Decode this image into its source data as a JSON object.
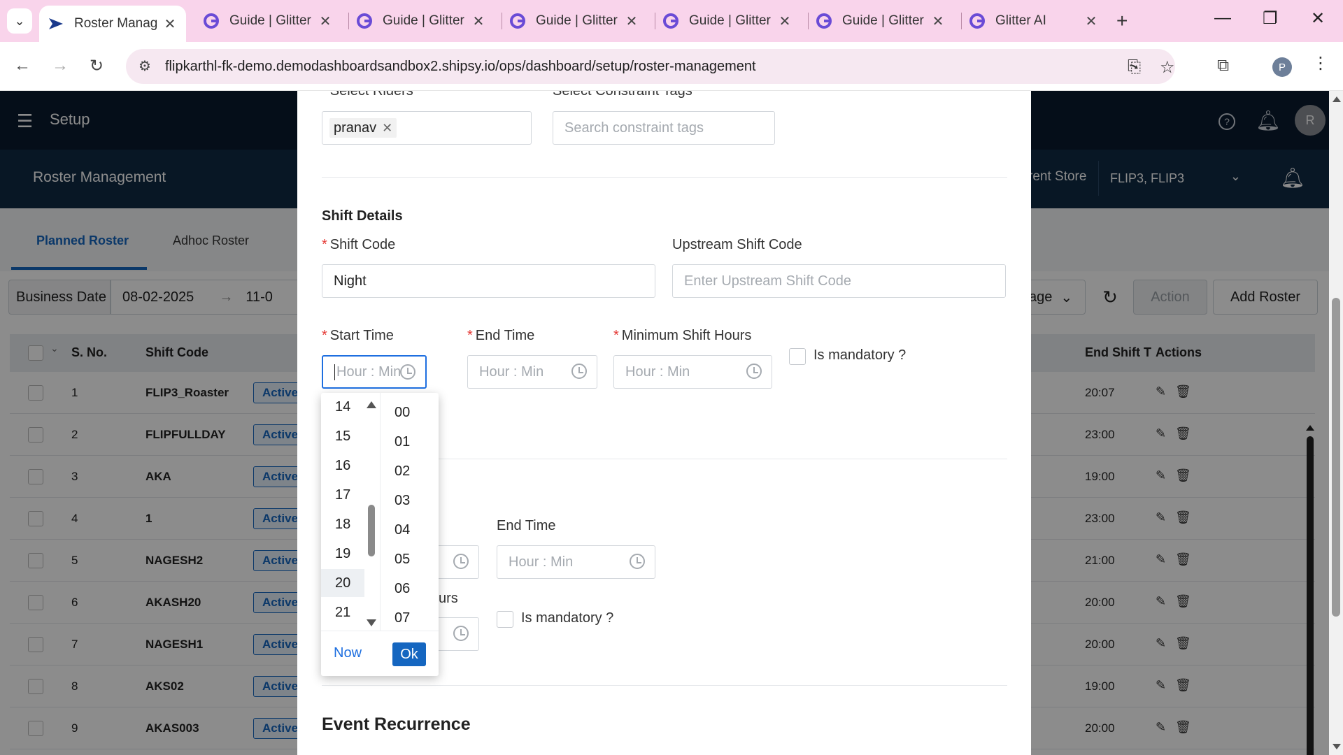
{
  "browser": {
    "tabs": [
      {
        "label": "Roster Manag",
        "active": true
      },
      {
        "label": "Guide | Glitter",
        "active": false
      },
      {
        "label": "Guide | Glitter",
        "active": false
      },
      {
        "label": "Guide | Glitter",
        "active": false
      },
      {
        "label": "Guide | Glitter",
        "active": false
      },
      {
        "label": "Guide | Glitter",
        "active": false
      },
      {
        "label": "Glitter AI",
        "active": false
      }
    ],
    "url": "flipkarthl-fk-demo.demodashboardsandbox2.shipsy.io/ops/dashboard/setup/roster-management",
    "profile_initial": "P"
  },
  "app": {
    "title": "Setup",
    "avatar_initial": "R",
    "sub_title": "Roster Management",
    "store_label": "rent Store",
    "store_value": "FLIP3, FLIP3",
    "tabs": [
      "Planned Roster",
      "Adhoc Roster"
    ],
    "business_date_label": "Business Date",
    "business_date_from": "08-02-2025",
    "business_date_to": "11-0",
    "page_size_fragment": "age",
    "action_label": "Action",
    "add_roster_label": "Add Roster",
    "table": {
      "headers": {
        "sno": "S. No.",
        "shift_code": "Shift Code",
        "end_shift": "End Shift T",
        "actions": "Actions"
      },
      "rows": [
        {
          "sno": "1",
          "code": "FLIP3_Roaster",
          "status": "Active",
          "end": "20:07"
        },
        {
          "sno": "2",
          "code": "FLIPFULLDAY",
          "status": "Active",
          "end": "23:00"
        },
        {
          "sno": "3",
          "code": "AKA",
          "status": "Active",
          "end": "19:00"
        },
        {
          "sno": "4",
          "code": "1",
          "status": "Active",
          "end": "23:00"
        },
        {
          "sno": "5",
          "code": "NAGESH2",
          "status": "Active",
          "end": "21:00"
        },
        {
          "sno": "6",
          "code": "AKASH20",
          "status": "Active",
          "end": "20:00"
        },
        {
          "sno": "7",
          "code": "NAGESH1",
          "status": "Active",
          "end": "20:00"
        },
        {
          "sno": "8",
          "code": "AKS02",
          "status": "Active",
          "end": "19:00"
        },
        {
          "sno": "9",
          "code": "AKAS003",
          "status": "Active",
          "end": "20:00"
        }
      ]
    }
  },
  "modal": {
    "select_riders_label": "Select Riders",
    "rider_tag": "pranav",
    "constraint_tags_label": "Select Constraint Tags",
    "constraint_tags_placeholder": "Search constraint tags",
    "shift_details_heading": "Shift Details",
    "shift_code_label": "Shift Code",
    "shift_code_value": "Night",
    "upstream_label": "Upstream Shift Code",
    "upstream_placeholder": "Enter Upstream Shift Code",
    "start_time_label": "Start Time",
    "end_time_label": "End Time",
    "min_hours_label": "Minimum Shift Hours",
    "time_placeholder": "Hour : Min",
    "mandatory_label": "Is mandatory ?",
    "second_end_time_label": "End Time",
    "second_hours_fragment": "urs",
    "second_mandatory_label": "Is mandatory ?",
    "event_recurrence_heading": "Event Recurrence"
  },
  "picker": {
    "hours": [
      "14",
      "15",
      "16",
      "17",
      "18",
      "19",
      "20",
      "21"
    ],
    "selected_hour": "20",
    "minutes": [
      "00",
      "01",
      "02",
      "03",
      "04",
      "05",
      "06",
      "07"
    ],
    "now_label": "Now",
    "ok_label": "Ok"
  },
  "colors": {
    "accent": "#1566c0",
    "focus_border": "#1e6fe0",
    "required": "#e53935",
    "tab_strip": "#f9d4eb"
  }
}
